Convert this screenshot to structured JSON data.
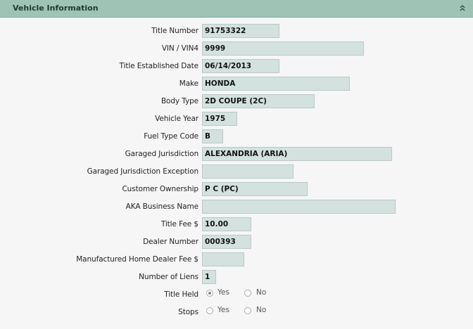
{
  "section": {
    "title": "Vehicle Information"
  },
  "fields": [
    {
      "label": "Title Number",
      "value": "91753322"
    },
    {
      "label": "VIN / VIN4",
      "value": "9999"
    },
    {
      "label": "Title Established Date",
      "value": "06/14/2013"
    },
    {
      "label": "Make",
      "value": "HONDA"
    },
    {
      "label": "Body Type",
      "value": "2D COUPE (2C)"
    },
    {
      "label": "Vehicle Year",
      "value": "1975"
    },
    {
      "label": "Fuel Type Code",
      "value": "B"
    },
    {
      "label": "Garaged Jurisdiction",
      "value": "ALEXANDRIA (ARIA)"
    },
    {
      "label": "Garaged Jurisdiction Exception",
      "value": ""
    },
    {
      "label": "Customer Ownership",
      "value": "P C (PC)"
    },
    {
      "label": "AKA Business Name",
      "value": ""
    },
    {
      "label": "Title Fee $",
      "value": "10.00"
    },
    {
      "label": "Dealer Number",
      "value": "000393"
    },
    {
      "label": "Manufactured Home Dealer Fee $",
      "value": ""
    },
    {
      "label": "Number of Liens",
      "value": "1"
    }
  ],
  "radios": [
    {
      "label": "Title Held",
      "yes": "Yes",
      "no": "No",
      "selected": "Yes"
    },
    {
      "label": "Stops",
      "yes": "Yes",
      "no": "No",
      "selected": ""
    }
  ]
}
